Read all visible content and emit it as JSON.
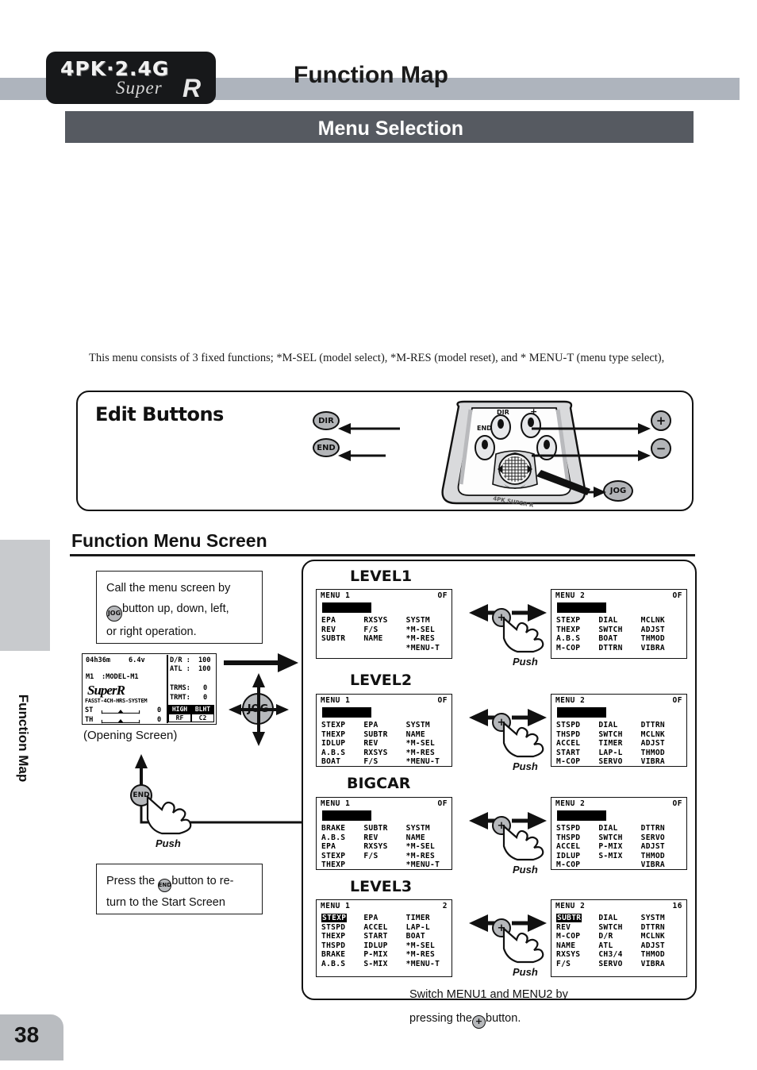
{
  "header": {
    "logo_line1": "4PK·2.4G",
    "logo_super": "Super",
    "logo_r": "R",
    "page_title": "Function Map",
    "section_title": "Menu Selection"
  },
  "side_tab": {
    "label": "Function Map",
    "page_number": "38"
  },
  "intro_text": "This menu consists of 3 fixed functions; *M-SEL (model select), *M-RES (model reset), and * MENU-T (menu type select),",
  "edit_buttons": {
    "title": "Edit Buttons",
    "left_labels": [
      "DIR",
      "END"
    ],
    "right_labels": [
      "+",
      "−"
    ],
    "jog_label": "JOG",
    "device_top_labels": [
      "DIR",
      "+",
      "END",
      "−"
    ],
    "device_footer": "4PK SUPER R"
  },
  "function_menu_screen": {
    "title": "Function Menu Screen",
    "callout_top": "Call the menu screen by",
    "callout_top_2": "button up, down, left,",
    "callout_top_3": "or right operation.",
    "callout_top_badge": "JOG",
    "opening_caption": "(Opening Screen)",
    "jog_badge": "JOG",
    "push_label": "Push",
    "callout_bottom_1": "Press the",
    "callout_bottom_2": "button to re-",
    "callout_bottom_3": "turn to the Start Screen",
    "callout_bottom_badge": "END",
    "bottom_caption_1": "Switch MENU1 and MENU2 by",
    "bottom_caption_2": "pressing the",
    "bottom_caption_3": "button.",
    "bottom_caption_badge": "+",
    "plus_badge": "+"
  },
  "opening_screen": {
    "timer": "04h36m",
    "voltage": "6.4v",
    "model_id": "M1",
    "model_name": ":MODEL-M1",
    "brand": "SuperR",
    "system": "FASST-4CH-HRS-SYSTEM",
    "st_label": "ST",
    "st_value": "0",
    "th_label": "TH",
    "th_value": "0",
    "dr_label": "D/R :",
    "dr_value": "100",
    "atl_label": "ATL :",
    "atl_value": "100",
    "trms_label": "TRMS:",
    "trms_value": "0",
    "trmt_label": "TRMT:",
    "trmt_value": "0",
    "btn_high": "HIGH",
    "btn_blht": "BLHT",
    "btn_rf": "RF",
    "btn_c2": "C2"
  },
  "levels": [
    {
      "name": "LEVEL1",
      "menu1": {
        "title": "MENU 1",
        "corner": "OF",
        "has_bar": true,
        "selected": null,
        "columns": [
          [
            "EPA",
            "REV",
            "SUBTR",
            ""
          ],
          [
            "RXSYS",
            "F/S",
            "NAME",
            ""
          ],
          [
            "SYSTM",
            "*M-SEL",
            "*M-RES",
            "*MENU-T"
          ]
        ]
      },
      "menu2": {
        "title": "MENU 2",
        "corner": "OF",
        "has_bar": true,
        "selected": null,
        "columns": [
          [
            "STEXP",
            "THEXP",
            "A.B.S",
            "M-COP"
          ],
          [
            "DIAL",
            "SWTCH",
            "BOAT",
            "DTTRN"
          ],
          [
            "MCLNK",
            "ADJST",
            "THMOD",
            "VIBRA"
          ]
        ]
      }
    },
    {
      "name": "LEVEL2",
      "menu1": {
        "title": "MENU 1",
        "corner": "OF",
        "has_bar": true,
        "selected": null,
        "columns": [
          [
            "STEXP",
            "THEXP",
            "IDLUP",
            "A.B.S",
            "BOAT"
          ],
          [
            "EPA",
            "SUBTR",
            "REV",
            "RXSYS",
            "F/S"
          ],
          [
            "SYSTM",
            "NAME",
            "*M-SEL",
            "*M-RES",
            "*MENU-T"
          ]
        ]
      },
      "menu2": {
        "title": "MENU 2",
        "corner": "OF",
        "has_bar": true,
        "selected": null,
        "columns": [
          [
            "STSPD",
            "THSPD",
            "ACCEL",
            "START",
            "M-COP"
          ],
          [
            "DIAL",
            "SWTCH",
            "TIMER",
            "LAP-L",
            "SERVO"
          ],
          [
            "DTTRN",
            "MCLNK",
            "ADJST",
            "THMOD",
            "VIBRA"
          ]
        ]
      }
    },
    {
      "name": "BIGCAR",
      "menu1": {
        "title": "MENU 1",
        "corner": "OF",
        "has_bar": true,
        "selected": null,
        "columns": [
          [
            "BRAKE",
            "A.B.S",
            "EPA",
            "STEXP",
            "THEXP"
          ],
          [
            "SUBTR",
            "REV",
            "RXSYS",
            "F/S",
            ""
          ],
          [
            "SYSTM",
            "NAME",
            "*M-SEL",
            "*M-RES",
            "*MENU-T"
          ]
        ]
      },
      "menu2": {
        "title": "MENU 2",
        "corner": "OF",
        "has_bar": true,
        "selected": null,
        "columns": [
          [
            "STSPD",
            "THSPD",
            "ACCEL",
            "IDLUP",
            "M-COP"
          ],
          [
            "DIAL",
            "SWTCH",
            "P-MIX",
            "S-MIX",
            ""
          ],
          [
            "DTTRN",
            "SERVO",
            "ADJST",
            "THMOD",
            "VIBRA"
          ]
        ]
      }
    },
    {
      "name": "LEVEL3",
      "menu1": {
        "title": "MENU 1",
        "corner": "2",
        "has_bar": false,
        "selected": "STEXP",
        "columns": [
          [
            "STEXP",
            "STSPD",
            "THEXP",
            "THSPD",
            "BRAKE",
            "A.B.S"
          ],
          [
            "EPA",
            "ACCEL",
            "START",
            "IDLUP",
            "P-MIX",
            "S-MIX"
          ],
          [
            "TIMER",
            "LAP-L",
            "BOAT",
            "*M-SEL",
            "*M-RES",
            "*MENU-T"
          ]
        ]
      },
      "menu2": {
        "title": "MENU 2",
        "corner": "16",
        "has_bar": false,
        "selected": "SUBTR",
        "columns": [
          [
            "SUBTR",
            "REV",
            "M-COP",
            "NAME",
            "RXSYS",
            "F/S"
          ],
          [
            "DIAL",
            "SWTCH",
            "D/R",
            "ATL",
            "CH3/4",
            "SERVO"
          ],
          [
            "SYSTM",
            "DTTRN",
            "MCLNK",
            "ADJST",
            "THMOD",
            "VIBRA"
          ]
        ]
      }
    }
  ],
  "colors": {
    "band": "#aeb4bd",
    "section_band": "#565a61",
    "side_tab": "#c8cacd",
    "badge": "#b6b8bb",
    "ink": "#111111"
  }
}
